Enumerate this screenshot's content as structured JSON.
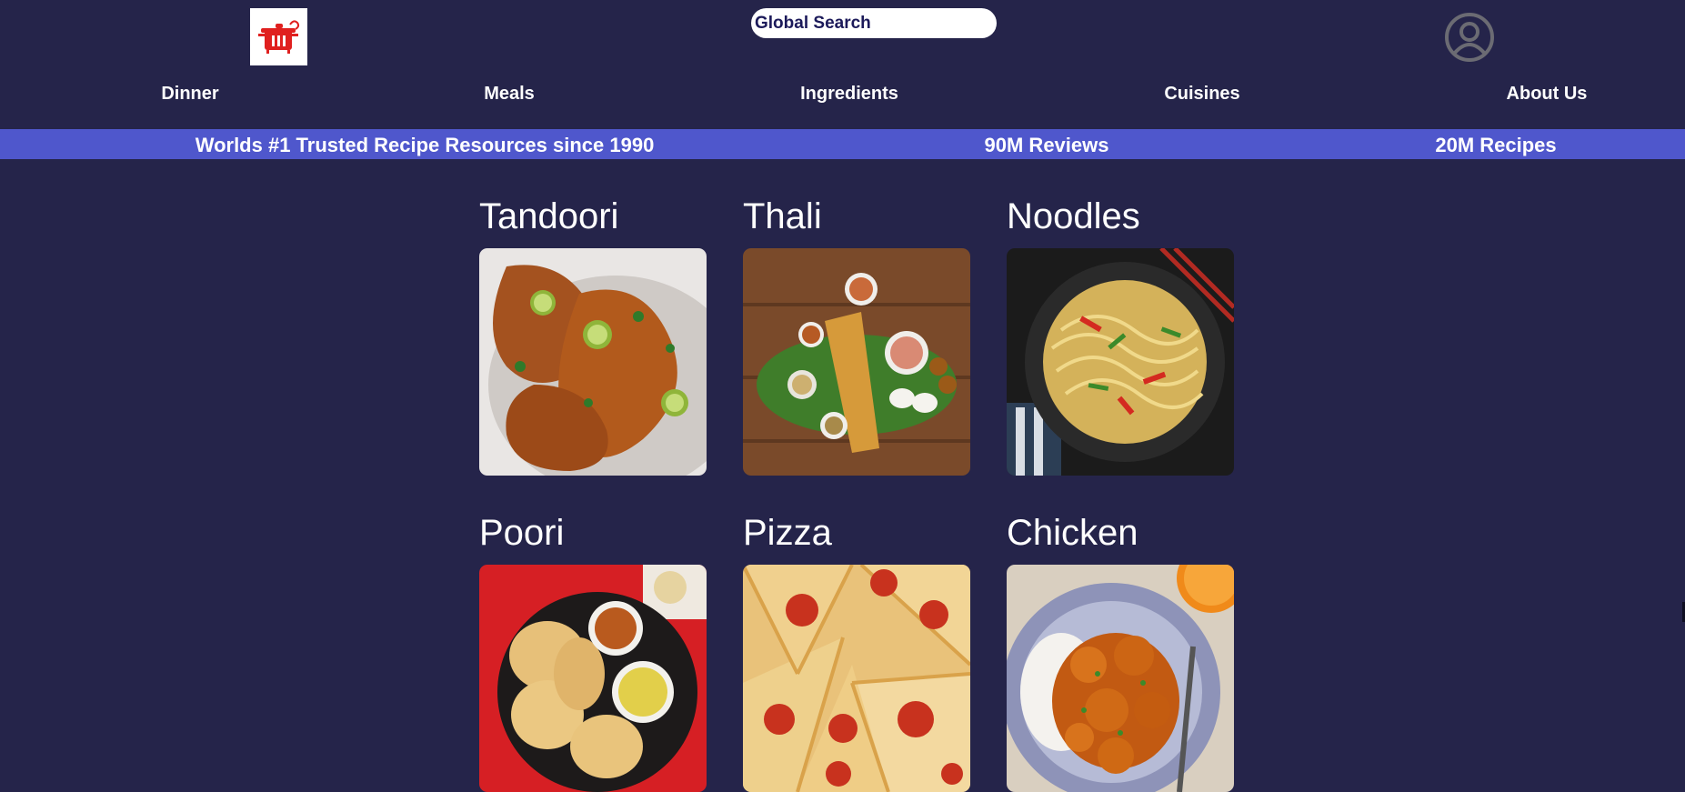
{
  "header": {
    "logo_icon": "cooking-pot-icon",
    "search": {
      "placeholder": "Global Search",
      "icon": "search-field"
    },
    "profile_icon": "user-avatar-icon"
  },
  "nav": {
    "items": [
      {
        "label": "Dinner"
      },
      {
        "label": "Meals"
      },
      {
        "label": "Ingredients"
      },
      {
        "label": "Cuisines"
      },
      {
        "label": "About Us"
      }
    ]
  },
  "banner": {
    "tagline": "Worlds #1 Trusted Recipe Resources since 1990",
    "reviews": "90M Reviews",
    "recipes": "20M Recipes"
  },
  "categories": [
    {
      "title": "Tandoori",
      "image": "tandoori-chicken-photo"
    },
    {
      "title": "Thali",
      "image": "south-indian-thali-photo"
    },
    {
      "title": "Noodles",
      "image": "veg-noodles-photo"
    },
    {
      "title": "Poori",
      "image": "poori-with-curry-photo"
    },
    {
      "title": "Pizza",
      "image": "pepperoni-pizza-photo"
    },
    {
      "title": "Chicken",
      "image": "chilli-chicken-rice-photo"
    }
  ],
  "colors": {
    "background": "#25244a",
    "banner": "#4f57cc",
    "text": "#ffffff",
    "search_text": "#1c1a5a",
    "logo_red": "#e0201f"
  }
}
